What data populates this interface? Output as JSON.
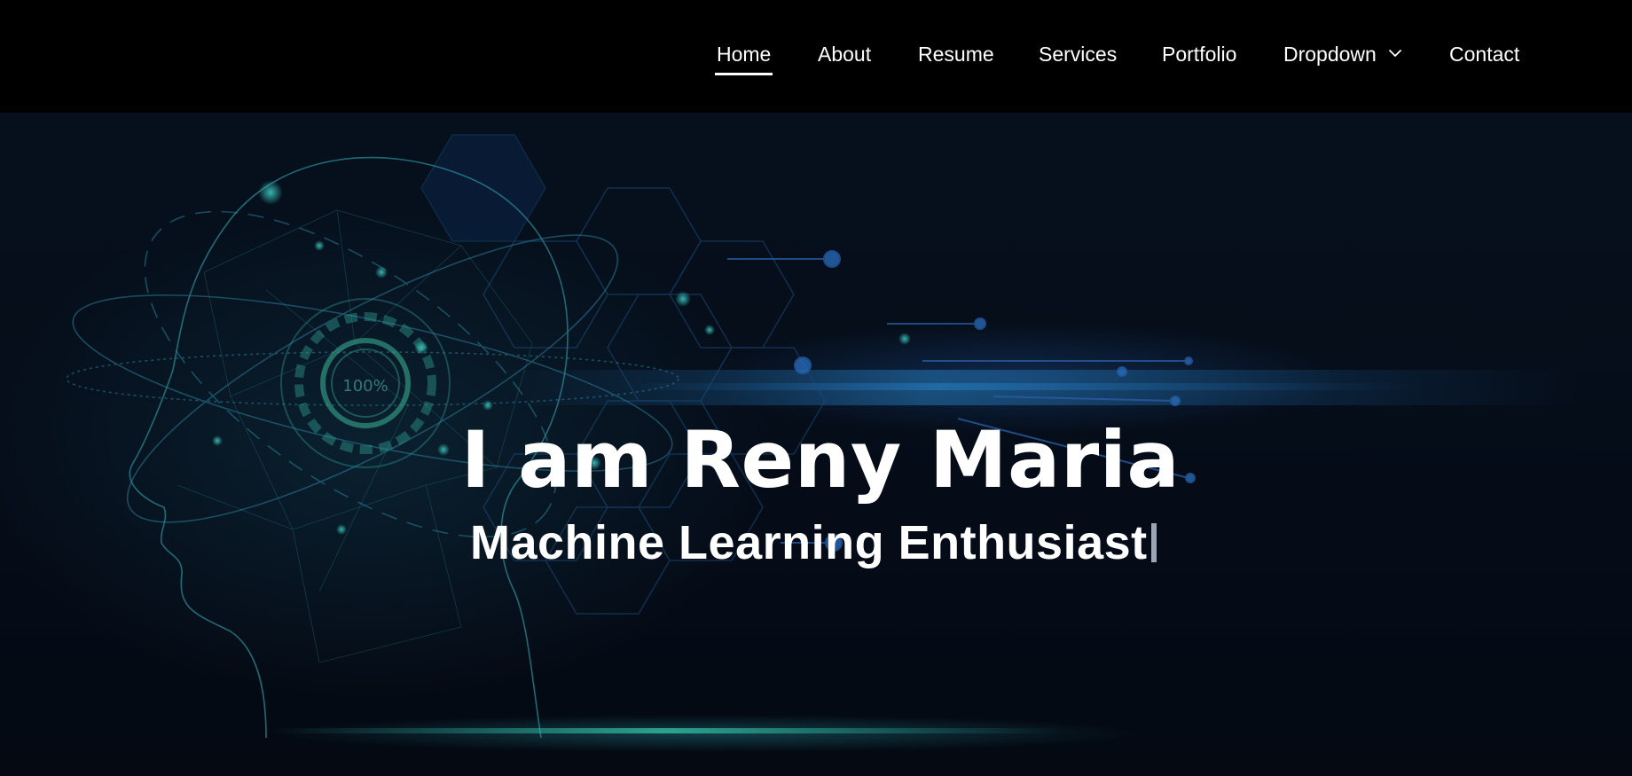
{
  "nav": {
    "items": [
      {
        "label": "Home",
        "active": true
      },
      {
        "label": "About"
      },
      {
        "label": "Resume"
      },
      {
        "label": "Services"
      },
      {
        "label": "Portfolio"
      },
      {
        "label": "Dropdown",
        "has_submenu": true,
        "icon": "chevron-down-icon"
      },
      {
        "label": "Contact"
      }
    ]
  },
  "hero": {
    "title": "I am Reny Maria",
    "subtitle": "Machine Learning Enthusiast",
    "gauge_text": "100%"
  },
  "colors": {
    "header_bg": "#000000",
    "hero_bg": "#050c18",
    "text": "#ffffff",
    "accent": "#2a8fb0"
  }
}
